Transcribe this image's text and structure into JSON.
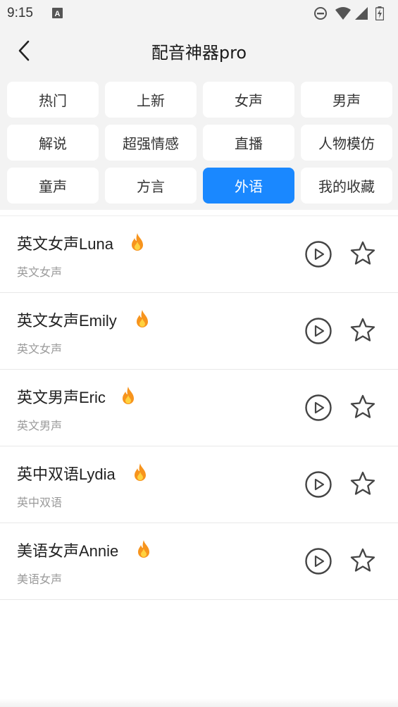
{
  "status": {
    "time": "9:15",
    "icons": [
      "a-icon",
      "dnd-icon",
      "wifi-icon",
      "signal-icon",
      "battery-icon"
    ]
  },
  "header": {
    "title": "配音神器pro",
    "back_icon": "chevron-left-icon"
  },
  "categories": [
    {
      "label": "热门",
      "active": false
    },
    {
      "label": "上新",
      "active": false
    },
    {
      "label": "女声",
      "active": false
    },
    {
      "label": "男声",
      "active": false
    },
    {
      "label": "解说",
      "active": false
    },
    {
      "label": "超强情感",
      "active": false
    },
    {
      "label": "直播",
      "active": false
    },
    {
      "label": "人物模仿",
      "active": false
    },
    {
      "label": "童声",
      "active": false
    },
    {
      "label": "方言",
      "active": false
    },
    {
      "label": "外语",
      "active": true
    },
    {
      "label": "我的收藏",
      "active": false
    }
  ],
  "voices": [
    {
      "name": "英文女声Luna",
      "subtitle": "英文女声",
      "hot": true
    },
    {
      "name": "英文女声Emily",
      "subtitle": "英文女声",
      "hot": true
    },
    {
      "name": "英文男声Eric",
      "subtitle": "英文男声",
      "hot": true
    },
    {
      "name": "英中双语Lydia",
      "subtitle": "英中双语",
      "hot": true
    },
    {
      "name": "美语女声Annie",
      "subtitle": "美语女声",
      "hot": true
    }
  ],
  "colors": {
    "accent": "#1a88ff",
    "background": "#f3f3f3",
    "subtitle": "#9a9a9a",
    "fire": "#f7941d"
  }
}
